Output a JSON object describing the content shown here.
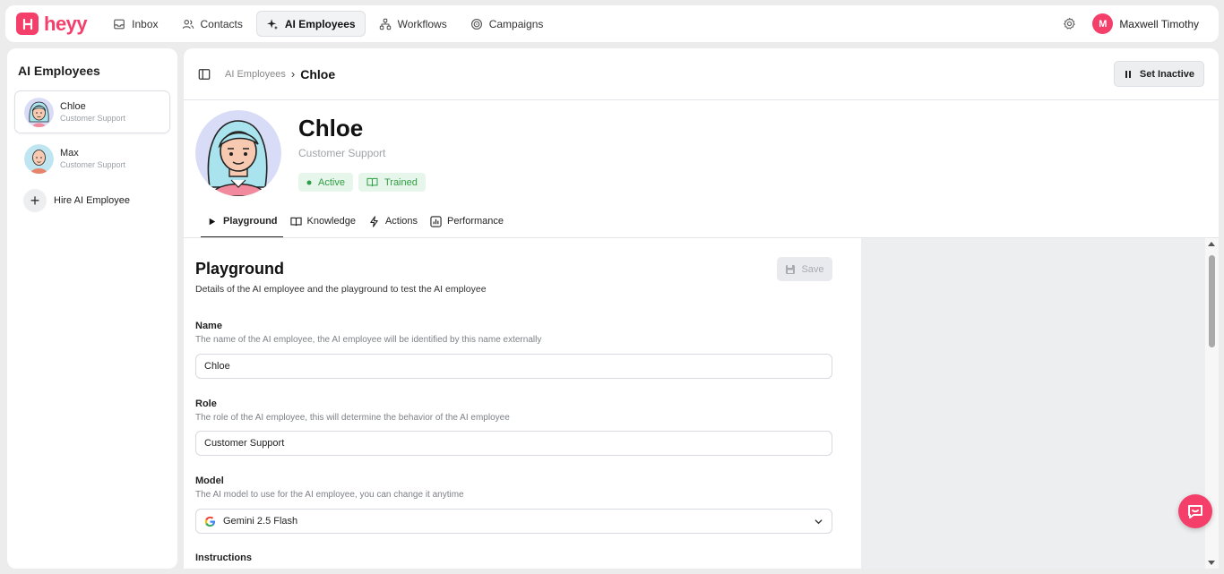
{
  "app": {
    "brand": "heyy",
    "brand_color": "#f43f6b"
  },
  "nav": {
    "items": [
      {
        "label": "Inbox",
        "icon": "inbox-icon"
      },
      {
        "label": "Contacts",
        "icon": "contacts-icon"
      },
      {
        "label": "AI Employees",
        "icon": "sparkle-icon",
        "active": true
      },
      {
        "label": "Workflows",
        "icon": "workflow-icon"
      },
      {
        "label": "Campaigns",
        "icon": "campaign-icon"
      }
    ],
    "user": {
      "initial": "M",
      "name": "Maxwell Timothy"
    }
  },
  "sidebar": {
    "title": "AI Employees",
    "employees": [
      {
        "name": "Chloe",
        "role": "Customer Support",
        "selected": true
      },
      {
        "name": "Max",
        "role": "Customer Support",
        "selected": false
      }
    ],
    "hire_label": "Hire AI Employee"
  },
  "header": {
    "breadcrumb_parent": "AI Employees",
    "breadcrumb_current": "Chloe",
    "set_inactive_label": "Set Inactive"
  },
  "profile": {
    "name": "Chloe",
    "role": "Customer Support",
    "badges": [
      {
        "label": "Active",
        "icon": "dot-icon"
      },
      {
        "label": "Trained",
        "icon": "book-icon"
      }
    ]
  },
  "tabs": [
    {
      "label": "Playground",
      "icon": "play-icon",
      "active": true
    },
    {
      "label": "Knowledge",
      "icon": "book-icon"
    },
    {
      "label": "Actions",
      "icon": "bolt-icon"
    },
    {
      "label": "Performance",
      "icon": "chart-icon"
    }
  ],
  "playground": {
    "title": "Playground",
    "description": "Details of the AI employee and the playground to test the AI employee",
    "save_label": "Save",
    "fields": {
      "name": {
        "label": "Name",
        "help": "The name of the AI employee, the AI employee will be identified by this name externally",
        "value": "Chloe"
      },
      "role": {
        "label": "Role",
        "help": "The role of the AI employee, this will determine the behavior of the AI employee",
        "value": "Customer Support"
      },
      "model": {
        "label": "Model",
        "help": "The AI model to use for the AI employee, you can change it anytime",
        "value": "Gemini 2.5 Flash"
      },
      "instructions": {
        "label": "Instructions"
      }
    }
  }
}
